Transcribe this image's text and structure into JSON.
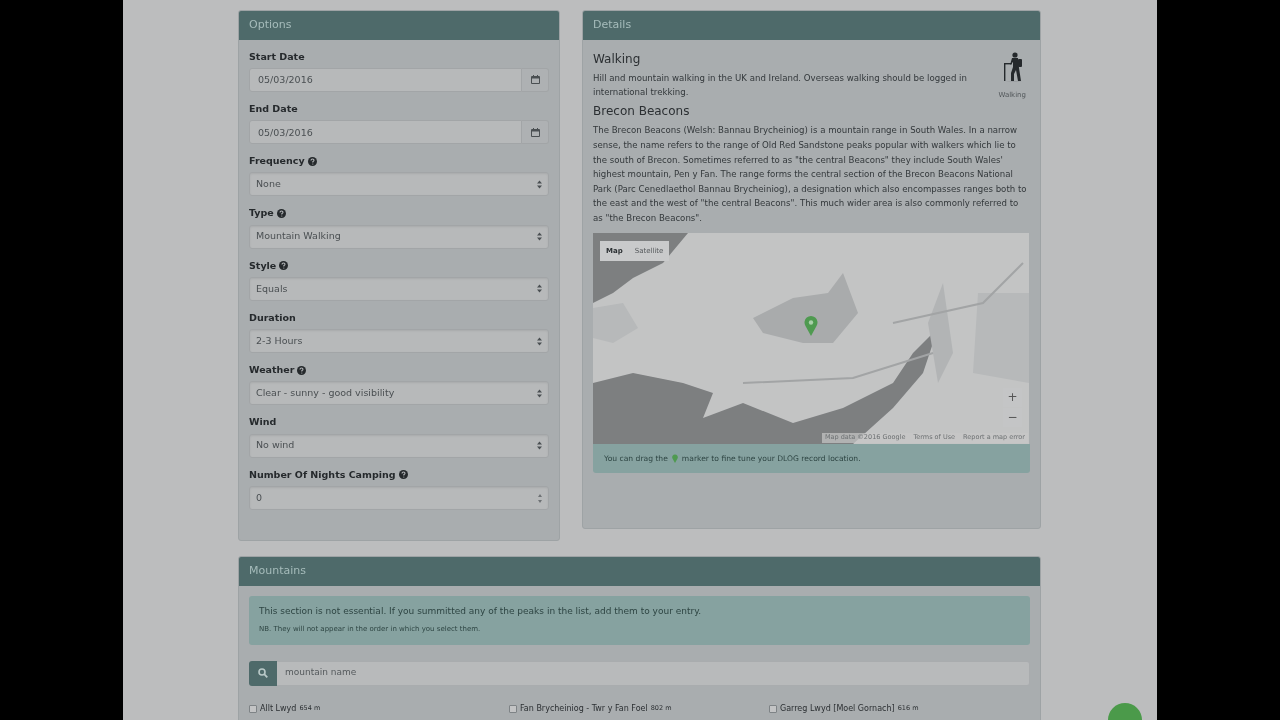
{
  "options": {
    "title": "Options",
    "fields": [
      {
        "kind": "date",
        "label": "Start Date",
        "help": false,
        "value": "05/03/2016"
      },
      {
        "kind": "date",
        "label": "End Date",
        "help": false,
        "value": "05/03/2016"
      },
      {
        "kind": "select",
        "label": "Frequency",
        "help": true,
        "value": "None"
      },
      {
        "kind": "select",
        "label": "Type",
        "help": true,
        "value": "Mountain Walking"
      },
      {
        "kind": "select",
        "label": "Style",
        "help": true,
        "value": "Equals"
      },
      {
        "kind": "select",
        "label": "Duration",
        "help": false,
        "value": "2-3 Hours"
      },
      {
        "kind": "select",
        "label": "Weather",
        "help": true,
        "value": "Clear - sunny - good visibility"
      },
      {
        "kind": "select",
        "label": "Wind",
        "help": false,
        "value": "No wind"
      },
      {
        "kind": "number",
        "label": "Number Of Nights Camping",
        "help": true,
        "value": "0"
      }
    ]
  },
  "details": {
    "title": "Details",
    "activity": {
      "heading": "Walking",
      "description": "Hill and mountain walking in the UK and Ireland. Overseas walking should be logged in international trekking.",
      "icon_caption": "Walking"
    },
    "area": {
      "heading": "Brecon Beacons",
      "description": "The Brecon Beacons (Welsh: Bannau Brycheiniog) is a mountain range in South Wales. In a narrow sense, the name refers to the range of Old Red Sandstone peaks popular with walkers which lie to the south of Brecon. Sometimes referred to as \"the central Beacons\" they include South Wales' highest mountain, Pen y Fan. The range forms the central section of the Brecon Beacons National Park (Parc Cenedlaethol Bannau Brycheiniog), a designation which also encompasses ranges both to the east and the west of \"the central Beacons\". This much wider area is also commonly referred to as \"the Brecon Beacons\"."
    },
    "map": {
      "kind": "picture",
      "map_types": [
        {
          "label": "Map",
          "selected": true
        },
        {
          "label": "Satellite",
          "selected": false
        }
      ],
      "zoom_in": "+",
      "zoom_out": "−",
      "attribution": [
        "Map data ©2016 Google",
        "Terms of Use",
        "Report a map error"
      ]
    },
    "marker_note": {
      "before": "You can drag the",
      "after": "marker to fine tune your DLOG record location."
    }
  },
  "mountains": {
    "title": "Mountains",
    "notice": "This section is not essential. If you summitted any of the peaks in the list, add them to your entry.",
    "note": "NB. They will not appear in the order in which you select them.",
    "search": {
      "placeholder": "mountain name"
    },
    "peaks": [
      {
        "name": "Allt Lwyd",
        "height": "654 m",
        "checked": false
      },
      {
        "name": "Fan Brycheiniog - Twr y Fan Foel",
        "height": "802 m",
        "checked": false
      },
      {
        "name": "Garreg Lwyd [Moel Gornach]",
        "height": "616 m",
        "checked": false
      }
    ]
  }
}
